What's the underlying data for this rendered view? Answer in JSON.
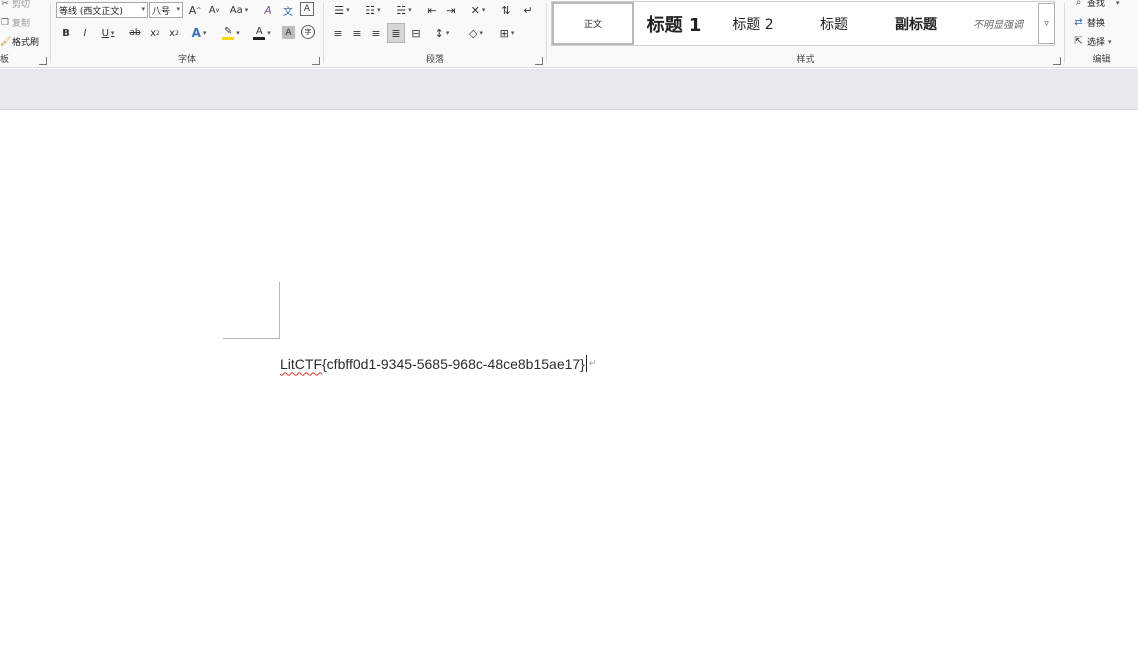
{
  "clipboard": {
    "cut_label": "剪切",
    "copy_label": "复制",
    "format_painter_label": "格式刷",
    "group_label": "板"
  },
  "font": {
    "font_name": "等线 (西文正文)",
    "font_size": "八号",
    "grow_label": "A",
    "shrink_label": "A",
    "case_label": "Aa",
    "clear_label": "A",
    "phonetic_label": "文",
    "border_label": "A",
    "bold_label": "B",
    "italic_label": "I",
    "underline_label": "U",
    "strike_label": "ab",
    "subscript_label": "x",
    "superscript_label": "x",
    "effects_label": "A",
    "highlight_label": "✎",
    "font_color_label": "A",
    "shading_label": "A",
    "enclose_label": "字",
    "group_label": "字体",
    "highlight_color": "#ffd500",
    "font_color": "#222222"
  },
  "paragraph": {
    "group_label": "段落"
  },
  "styles": {
    "items": [
      {
        "label": "正文"
      },
      {
        "label": "标题 1"
      },
      {
        "label": "标题 2"
      },
      {
        "label": "标题"
      },
      {
        "label": "副标题"
      },
      {
        "label": "不明显强调"
      }
    ],
    "more_label": "▿",
    "group_label": "样式"
  },
  "editing": {
    "find_label": "查找",
    "replace_label": "替换",
    "select_label": "选择",
    "group_label": "编辑"
  },
  "document": {
    "prefix": "LitCTF",
    "rest": "{cfbff0d1-9345-5685-968c-48ce8b15ae17}",
    "para_mark": "↵"
  }
}
